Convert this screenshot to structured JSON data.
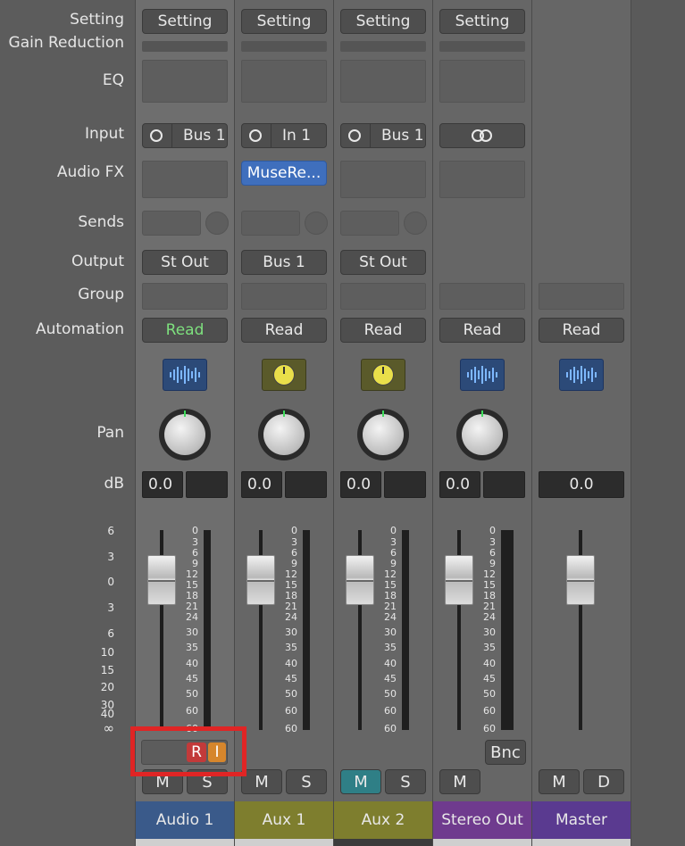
{
  "row_labels": {
    "setting": "Setting",
    "gain_reduction": "Gain Reduction",
    "eq": "EQ",
    "input": "Input",
    "audio_fx": "Audio FX",
    "sends": "Sends",
    "output": "Output",
    "group": "Group",
    "automation": "Automation",
    "pan": "Pan",
    "db": "dB"
  },
  "left_scale": [
    "6",
    "3",
    "0",
    "3",
    "6",
    "10",
    "15",
    "20",
    "30",
    "40",
    "∞"
  ],
  "meter_scale": [
    "0",
    "3",
    "6",
    "9",
    "12",
    "15",
    "18",
    "21",
    "24",
    "30",
    "35",
    "40",
    "45",
    "50",
    "60"
  ],
  "strips": [
    {
      "name": "Audio 1",
      "setting": "Setting",
      "input": "Bus 1",
      "output": "St Out",
      "automation": "Read",
      "db": "0.0",
      "mute": "M",
      "solo": "S",
      "color": "#3a5a8a"
    },
    {
      "name": "Aux 1",
      "setting": "Setting",
      "input": "In 1",
      "plugin": "MuseRe...",
      "output": "Bus 1",
      "automation": "Read",
      "db": "0.0",
      "mute": "M",
      "solo": "S",
      "color": "#7e7e2e"
    },
    {
      "name": "Aux 2",
      "setting": "Setting",
      "input": "Bus 1",
      "output": "St Out",
      "automation": "Read",
      "db": "0.0",
      "mute": "M",
      "solo": "S",
      "color": "#7e7e2e"
    },
    {
      "name": "Stereo Out",
      "setting": "Setting",
      "automation": "Read",
      "db": "0.0",
      "mute": "M",
      "bounce": "Bnc",
      "color": "#6f3b8e"
    },
    {
      "name": "Master",
      "automation": "Read",
      "db": "0.0",
      "mute": "M",
      "dim": "D",
      "color": "#5a3a90"
    }
  ],
  "record_button": "R",
  "input_monitor_button": "I"
}
